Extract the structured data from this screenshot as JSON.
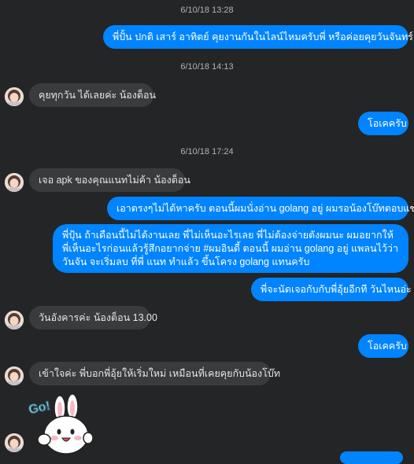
{
  "colors": {
    "background": "#242526",
    "outgoing_bubble": "#0084ff",
    "incoming_bubble": "#3a3b3c",
    "timestamp_text": "#b0b3b8"
  },
  "messages": {
    "ts1": "6/10/18 13:28",
    "m1": "พี่ปั้น ปกติ เสาร์ อาทิตย์ คุยงานกันในไลน์ไหมครับพี่ หรือค่อยคุยวันจันทร์ อะ",
    "ts2": "6/10/18 14:13",
    "m2": "คุยทุกวัน ได้เลยค่ะ น้องต็อน",
    "m3": "โอเคครับ",
    "ts3": "6/10/18 17:24",
    "m4": "เจอ apk ของคุณแนทไม่ค้า น้องต็อน",
    "m5": "เอาตรงๆไม่ได้หาครับ ตอนนี้ผมนั่งอ่าน golang อยู่ ผมรอน้องโบ๊ทตอบแชท",
    "m6": "พี่ปุ้น ถ้าเดือนนี้ไม่ได้งานเลย พี่ไม่เห็นอะไรเลย พี่ไม่ต้องจ่ายตังผมนะ ผมอยากให้พี่เห็นอะไรก่อนแล้วรู้สึกอยากจ่าย #ผมอินดี้ ตอนนี้ ผมอ่าน golang อยู่ แพลนไว้ว่าวันจัน จะเริ่มลบ ที่พี่ แนท ทำแล้ว ขึ้นโครง golang แทนครับ",
    "m7": "พี่จะนัดเจอกับกับพี่อุ้ยอีกที วันไหนอ่ะ",
    "m8": "วันอังคารค่ะ น้องต็อน 13.00",
    "m9": "โอเคครับ",
    "m10": "เข้าใจค่ะ พี่บอกพี่อุ้ยให้เริ่มใหม่ เหมือนที่เคยคุยกับน้องโบ๊ท"
  },
  "sticker": {
    "text": "Go!",
    "icon": "bunny-go-sticker"
  }
}
